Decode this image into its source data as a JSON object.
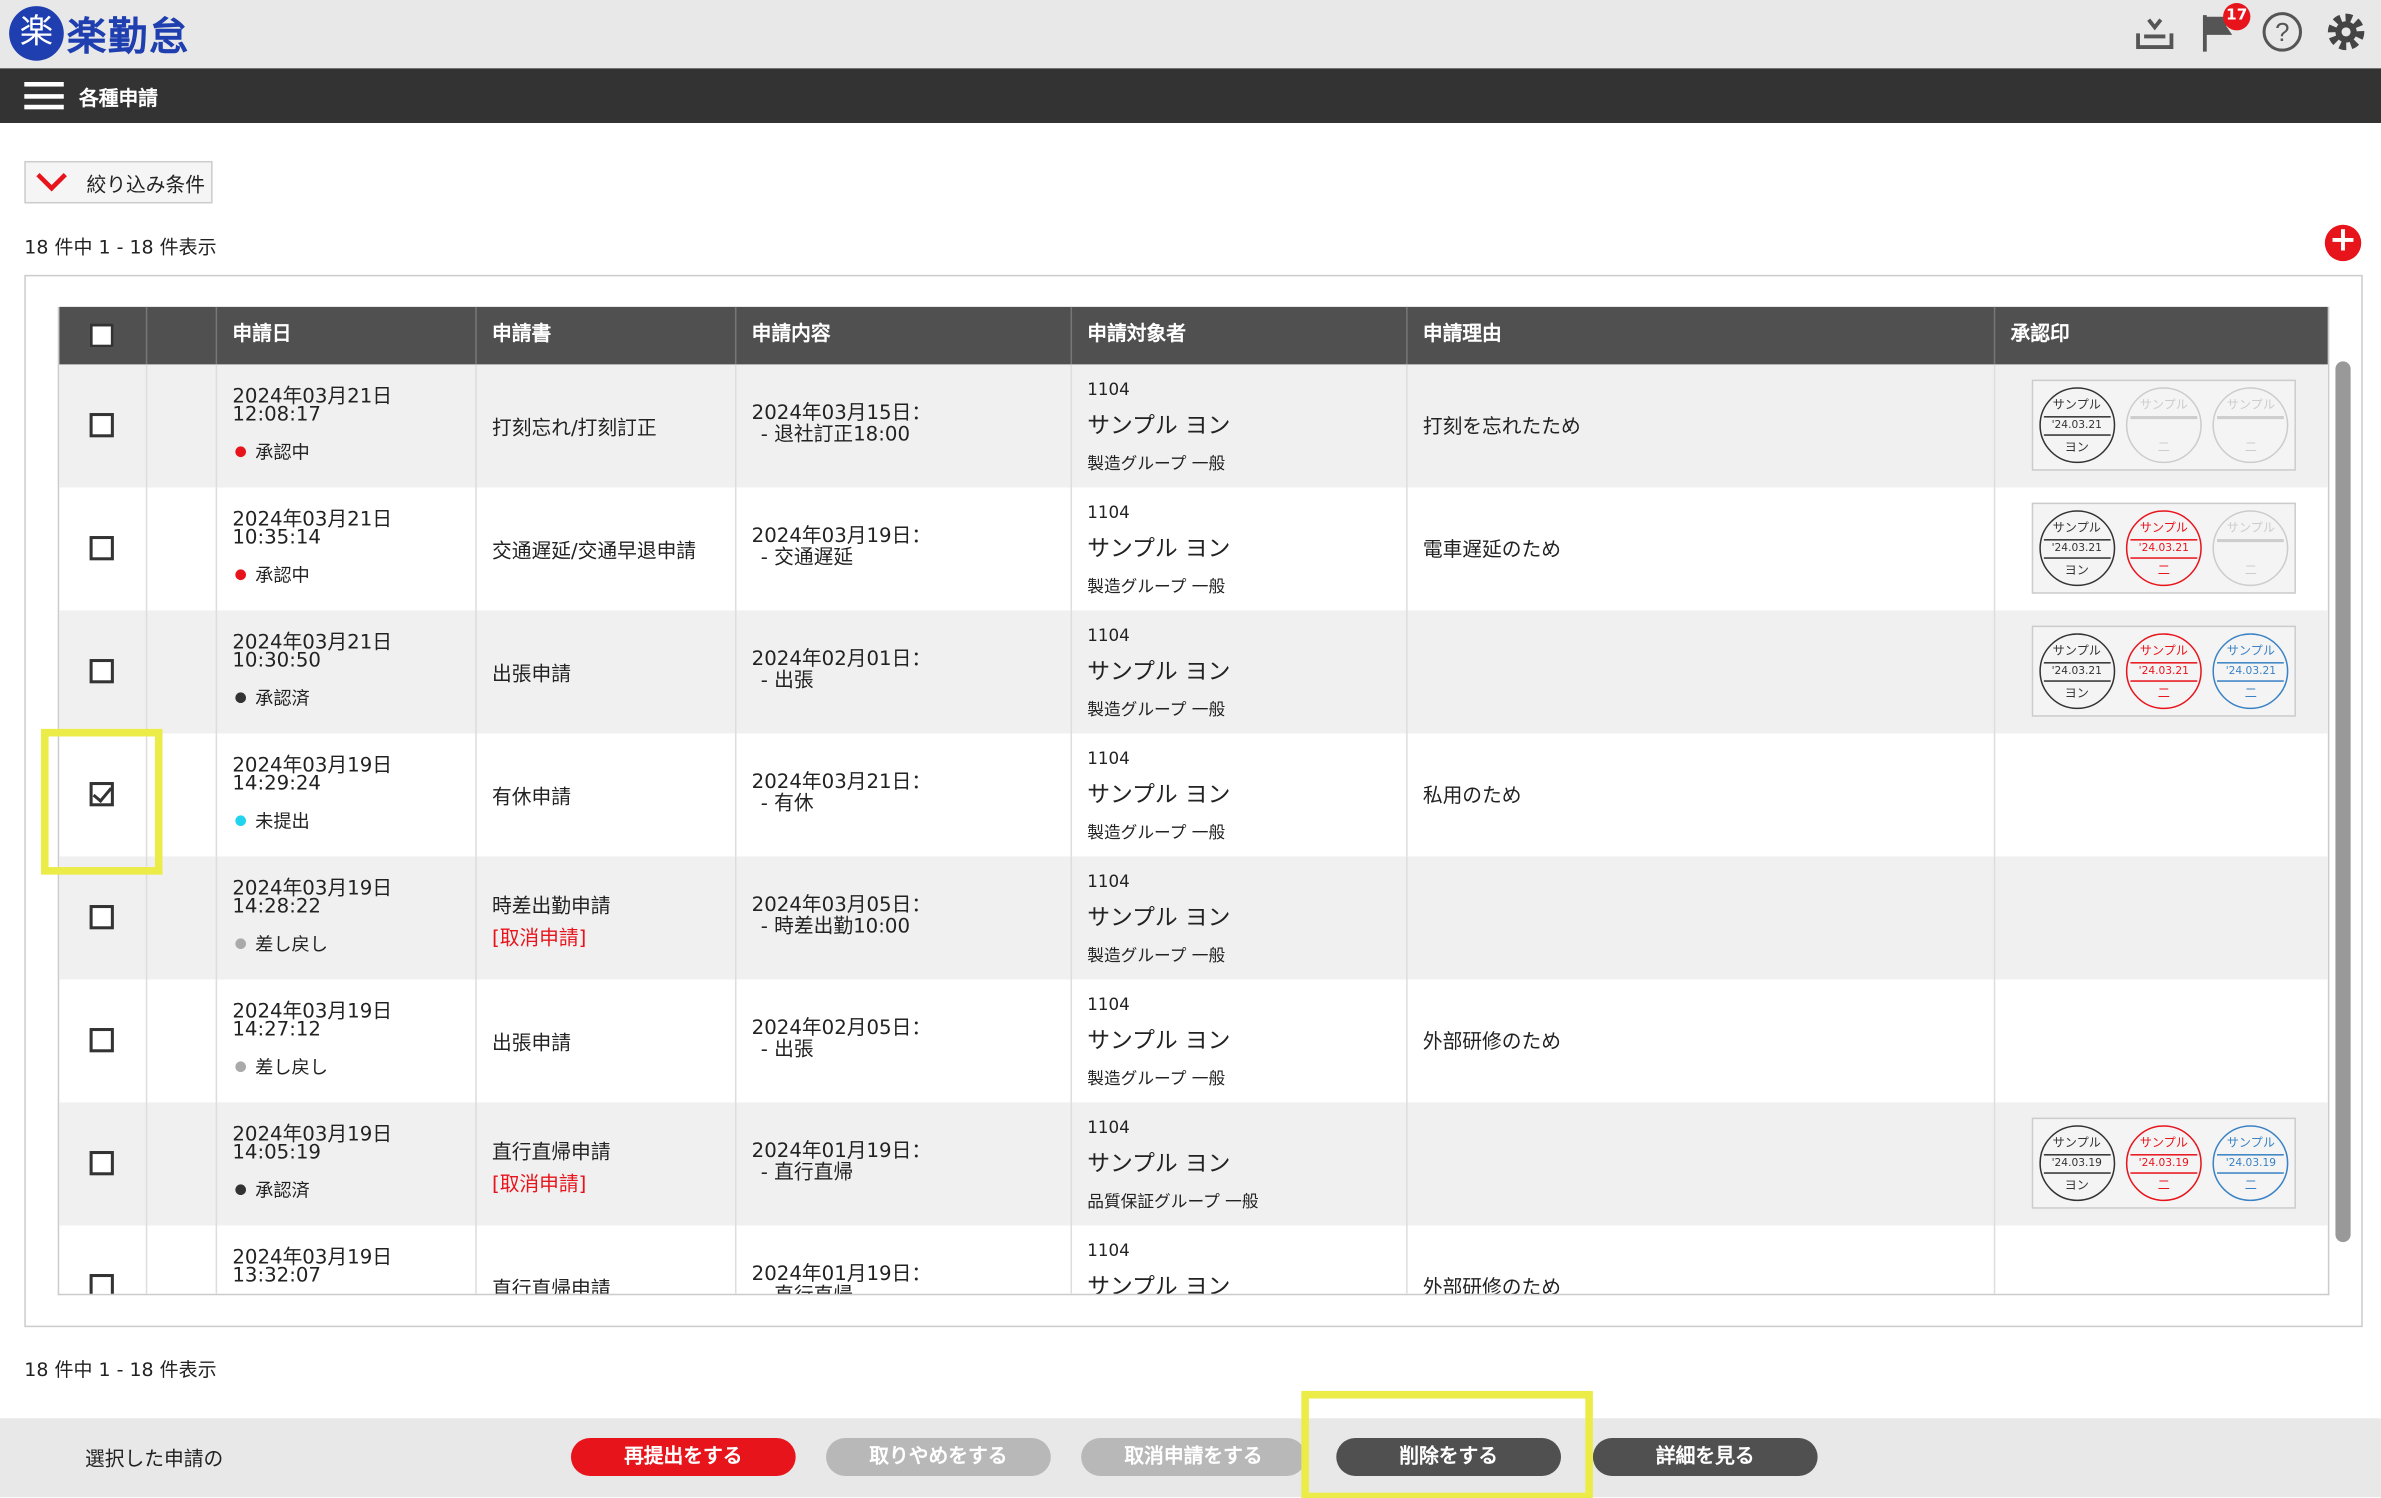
{
  "app": {
    "logo_char": "楽",
    "logo_text": "楽勤怠",
    "notif_count": "17"
  },
  "nav": {
    "title": "各種申請"
  },
  "filter": {
    "label": "絞り込み条件"
  },
  "pagination": {
    "top": "18 件中 1 - 18 件表示",
    "bottom": "18 件中 1 - 18 件表示"
  },
  "headers": [
    "申請日",
    "申請書",
    "申請内容",
    "申請対象者",
    "申請理由",
    "承認印"
  ],
  "rows": [
    {
      "checked": false,
      "date": "2024年03月21日\n12:08:17",
      "status": "承認中",
      "status_color": "#e8141c",
      "form": "打刻忘れ/打刻訂正",
      "cancel": "",
      "content1": "2024年03月15日：",
      "content2": "- 退社訂正18:00",
      "code": "1104",
      "name": "サンプル ヨン",
      "group": "製造グループ 一般",
      "reason": "打刻を忘れたため",
      "stamps": [
        {
          "type": "black",
          "date": "'24.03.21",
          "bottom": "ヨン"
        },
        {
          "type": "blank",
          "date": "",
          "bottom": "二"
        },
        {
          "type": "blank",
          "date": "",
          "bottom": "二"
        }
      ]
    },
    {
      "checked": false,
      "date": "2024年03月21日\n10:35:14",
      "status": "承認中",
      "status_color": "#e8141c",
      "form": "交通遅延/交通早退申請",
      "cancel": "",
      "content1": "2024年03月19日：",
      "content2": "- 交通遅延",
      "code": "1104",
      "name": "サンプル ヨン",
      "group": "製造グループ 一般",
      "reason": "電車遅延のため",
      "stamps": [
        {
          "type": "black",
          "date": "'24.03.21",
          "bottom": "ヨン"
        },
        {
          "type": "red",
          "date": "'24.03.21",
          "bottom": "二"
        },
        {
          "type": "blank",
          "date": "",
          "bottom": "二"
        }
      ]
    },
    {
      "checked": false,
      "date": "2024年03月21日\n10:30:50",
      "status": "承認済",
      "status_color": "#333333",
      "form": "出張申請",
      "cancel": "",
      "content1": "2024年02月01日：",
      "content2": "- 出張",
      "code": "1104",
      "name": "サンプル ヨン",
      "group": "製造グループ 一般",
      "reason": "",
      "stamps": [
        {
          "type": "black",
          "date": "'24.03.21",
          "bottom": "ヨン"
        },
        {
          "type": "red",
          "date": "'24.03.21",
          "bottom": "二"
        },
        {
          "type": "blue",
          "date": "'24.03.21",
          "bottom": "二"
        }
      ]
    },
    {
      "checked": true,
      "date": "2024年03月19日\n14:29:24",
      "status": "未提出",
      "status_color": "#22d3ee",
      "form": "有休申請",
      "cancel": "",
      "content1": "2024年03月21日：",
      "content2": "- 有休",
      "code": "1104",
      "name": "サンプル ヨン",
      "group": "製造グループ 一般",
      "reason": "私用のため",
      "stamps": []
    },
    {
      "checked": false,
      "date": "2024年03月19日\n14:28:22",
      "status": "差し戻し",
      "status_color": "#aaaaaa",
      "form": "時差出勤申請",
      "cancel": "[取消申請]",
      "content1": "2024年03月05日：",
      "content2": "- 時差出勤10:00",
      "code": "1104",
      "name": "サンプル ヨン",
      "group": "製造グループ 一般",
      "reason": "",
      "stamps": []
    },
    {
      "checked": false,
      "date": "2024年03月19日\n14:27:12",
      "status": "差し戻し",
      "status_color": "#aaaaaa",
      "form": "出張申請",
      "cancel": "",
      "content1": "2024年02月05日：",
      "content2": "- 出張",
      "code": "1104",
      "name": "サンプル ヨン",
      "group": "製造グループ 一般",
      "reason": "外部研修のため",
      "stamps": []
    },
    {
      "checked": false,
      "date": "2024年03月19日\n14:05:19",
      "status": "承認済",
      "status_color": "#333333",
      "form": "直行直帰申請",
      "cancel": "[取消申請]",
      "content1": "2024年01月19日：",
      "content2": "- 直行直帰",
      "code": "1104",
      "name": "サンプル ヨン",
      "group": "品質保証グループ 一般",
      "reason": "",
      "stamps": [
        {
          "type": "black",
          "date": "'24.03.19",
          "bottom": "ヨン"
        },
        {
          "type": "red",
          "date": "'24.03.19",
          "bottom": "二"
        },
        {
          "type": "blue",
          "date": "'24.03.19",
          "bottom": "二"
        }
      ]
    },
    {
      "checked": false,
      "date": "2024年03月19日\n13:32:07",
      "status": "",
      "status_color": "#aaaaaa",
      "form": "直行直帰申請",
      "cancel": "",
      "content1": "2024年01月19日：",
      "content2": "- 直行直帰",
      "code": "1104",
      "name": "サンプル ヨン",
      "group": "",
      "reason": "外部研修のため",
      "stamps": []
    }
  ],
  "stamp_top": "サンプル",
  "footer": {
    "label": "選択した申請の",
    "buttons": [
      {
        "label": "再提出をする",
        "color": "#e8141c"
      },
      {
        "label": "取りやめをする",
        "color": "#b8b8b8"
      },
      {
        "label": "取消申請をする",
        "color": "#b8b8b8"
      },
      {
        "label": "削除をする",
        "color": "#505050"
      },
      {
        "label": "詳細を見る",
        "color": "#505050"
      }
    ]
  }
}
